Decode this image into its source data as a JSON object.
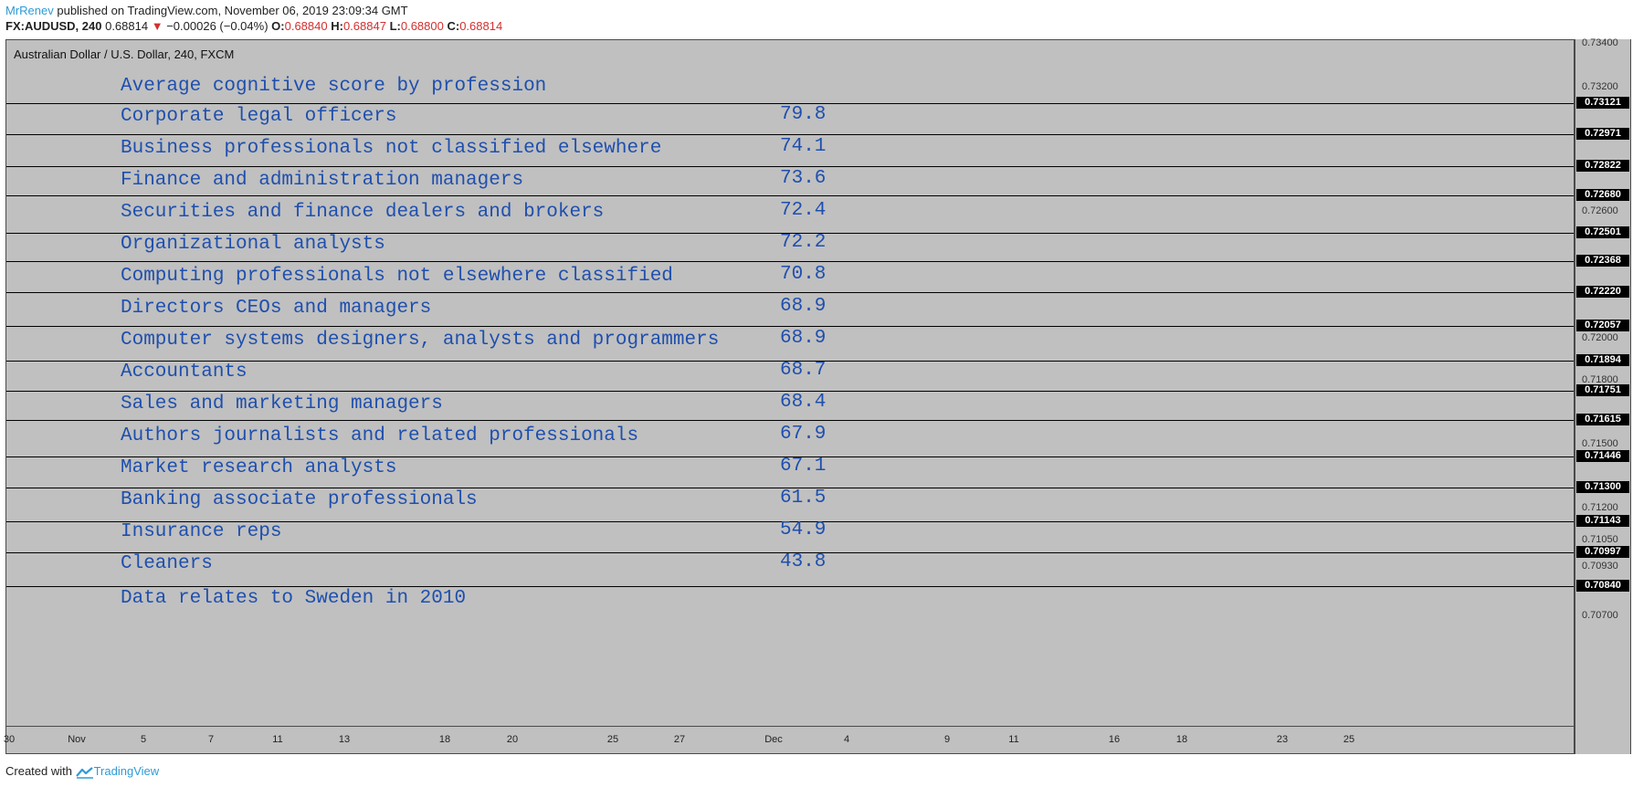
{
  "header": {
    "author": "MrRenev",
    "published_text": " published on TradingView.com, November 06, 2019 23:09:34 GMT",
    "symbol": "FX:AUDUSD, 240",
    "last": "0.68814",
    "change_arrow": "▼",
    "change": "−0.00026 (−0.04%)",
    "open_label": "O:",
    "open": "0.68840",
    "high_label": "H:",
    "high": "0.68847",
    "low_label": "L:",
    "low": "0.68800",
    "close_label": "C:",
    "close": "0.68814"
  },
  "chart": {
    "instrument": "Australian Dollar / U.S. Dollar, 240, FXCM",
    "title": "Average cognitive score by profession",
    "footnote": "Data relates to Sweden in 2010",
    "rows": [
      {
        "label": "Corporate legal officers",
        "value": "79.8"
      },
      {
        "label": "Business professionals not classified elsewhere",
        "value": "74.1"
      },
      {
        "label": "Finance and administration managers",
        "value": "73.6"
      },
      {
        "label": "Securities and finance dealers and brokers",
        "value": "72.4"
      },
      {
        "label": "Organizational analysts",
        "value": "72.2"
      },
      {
        "label": "Computing professionals not elsewhere classified",
        "value": "70.8"
      },
      {
        "label": "Directors CEOs and managers",
        "value": "68.9"
      },
      {
        "label": "Computer systems designers, analysts and programmers",
        "value": "68.9"
      },
      {
        "label": "Accountants",
        "value": "68.7"
      },
      {
        "label": "Sales and marketing managers",
        "value": "68.4"
      },
      {
        "label": "Authors journalists and related professionals",
        "value": "67.9"
      },
      {
        "label": "Market research analysts",
        "value": "67.1"
      },
      {
        "label": "Banking associate professionals",
        "value": "61.5"
      },
      {
        "label": "Insurance reps",
        "value": "54.9"
      },
      {
        "label": "Cleaners",
        "value": "43.8"
      }
    ]
  },
  "price_axis": {
    "ticks": [
      "0.73400",
      "0.73200",
      "0.72600",
      "0.72000",
      "0.71800",
      "0.71500",
      "0.71200",
      "0.71050",
      "0.70930",
      "0.70700"
    ],
    "tags": [
      "0.73121",
      "0.72971",
      "0.72822",
      "0.72680",
      "0.72501",
      "0.72368",
      "0.72220",
      "0.72057",
      "0.71894",
      "0.71751",
      "0.71615",
      "0.71446",
      "0.71300",
      "0.71143",
      "0.70997",
      "0.70840"
    ]
  },
  "time_axis": {
    "ticks": [
      "30",
      "Nov",
      "5",
      "7",
      "11",
      "13",
      "18",
      "20",
      "25",
      "27",
      "Dec",
      "4",
      "9",
      "11",
      "16",
      "18",
      "23",
      "25"
    ]
  },
  "footer": {
    "created_with": "Created with ",
    "brand": "TradingView"
  },
  "colors": {
    "chart_bg": "#c0c0c0",
    "text_blue": "#1e4fae",
    "author_blue": "#2e9bd6",
    "down_red": "#d32f2f"
  }
}
